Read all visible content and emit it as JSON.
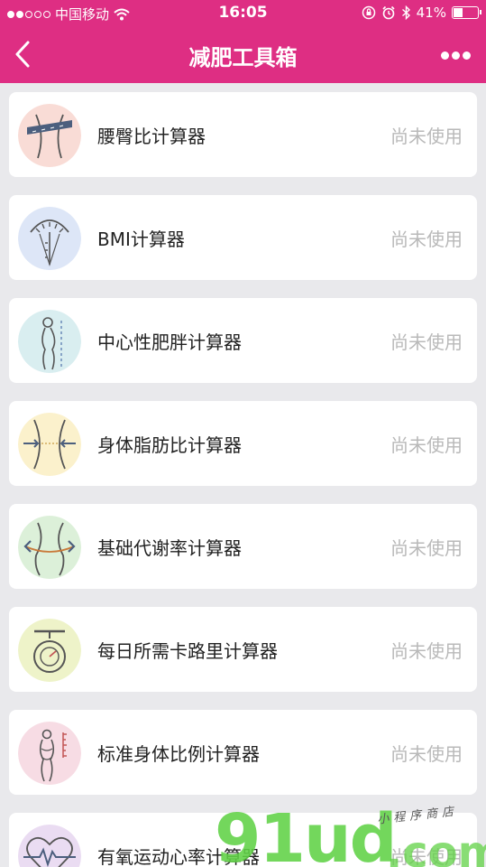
{
  "status_bar": {
    "carrier": "中国移动",
    "time": "16:05",
    "battery": "41%",
    "battery_level": 0.41
  },
  "nav": {
    "title": "减肥工具箱",
    "back_icon": "chevron-left-icon",
    "more_icon": "more-dots-icon"
  },
  "tools": [
    {
      "name": "腰臀比计算器",
      "status": "尚未使用",
      "icon": "waist-tape-icon",
      "icon_bg": "#f9dcd6"
    },
    {
      "name": "BMI计算器",
      "status": "尚未使用",
      "icon": "scale-gauge-icon",
      "icon_bg": "#dde6f7"
    },
    {
      "name": "中心性肥胖计算器",
      "status": "尚未使用",
      "icon": "body-profile-icon",
      "icon_bg": "#d9eef0"
    },
    {
      "name": "身体脂肪比计算器",
      "status": "尚未使用",
      "icon": "waist-arrows-icon",
      "icon_bg": "#fbf1cc"
    },
    {
      "name": "基础代谢率计算器",
      "status": "尚未使用",
      "icon": "hip-curve-icon",
      "icon_bg": "#dcf0d9"
    },
    {
      "name": "每日所需卡路里计算器",
      "status": "尚未使用",
      "icon": "kitchen-scale-icon",
      "icon_bg": "#eef3c9"
    },
    {
      "name": "标准身体比例计算器",
      "status": "尚未使用",
      "icon": "body-ruler-icon",
      "icon_bg": "#f7dce4"
    },
    {
      "name": "有氧运动心率计算器",
      "status": "尚未使用",
      "icon": "heart-rate-icon",
      "icon_bg": "#eadcf2"
    }
  ],
  "watermark": {
    "brand": "91ud",
    "suffix": ".com",
    "tagline": "小程序商店"
  },
  "colors": {
    "header": "#de2e83",
    "background": "#e9e9ec",
    "status_text": "#b9b9b9"
  }
}
